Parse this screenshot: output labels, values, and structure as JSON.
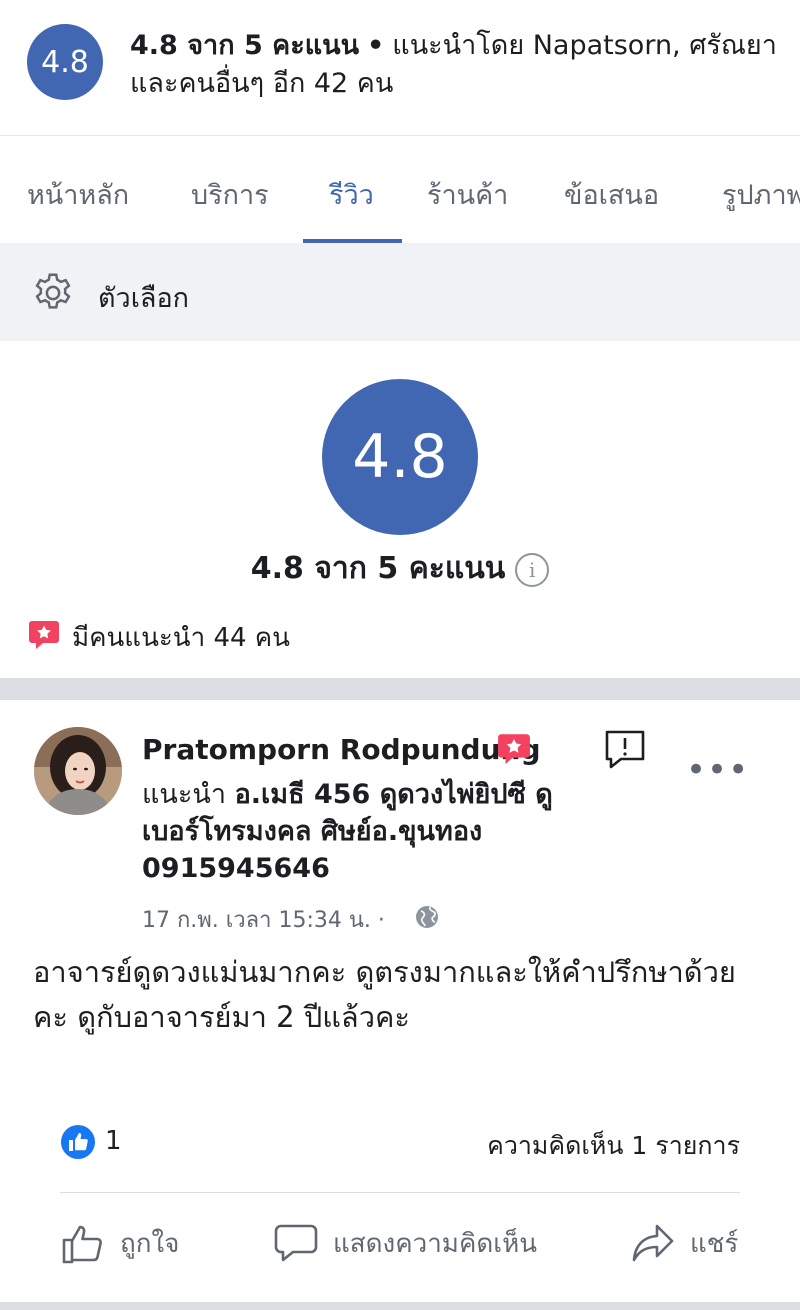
{
  "summary": {
    "badge": "4.8",
    "rating_text": "4.8 จาก 5 คะแนน",
    "dot": "•",
    "recommended_text": "แนะนำโดย Napatsorn, ศรัณยา และคนอื่นๆ อีก 42 คน"
  },
  "tabs": [
    {
      "label": "หน้าหลัก"
    },
    {
      "label": "บริการ"
    },
    {
      "label": "รีวิว",
      "active": true
    },
    {
      "label": "ร้านค้า"
    },
    {
      "label": "ข้อเสนอ"
    },
    {
      "label": "รูปภาพ"
    }
  ],
  "options": {
    "label": "ตัวเลือก",
    "icon": "gear-icon"
  },
  "rating": {
    "badge": "4.8",
    "text": "4.8 จาก 5 คะแนน",
    "info": "i",
    "recommend_count_text": "มีคนแนะนำ 44 คน"
  },
  "post": {
    "author": "Pratomporn Rodpundung",
    "recommend_prefix": "แนะนำ",
    "recommend_target": "อ.เมธี 456 ดูดวงไพ่ยิปซี ดูเบอร์โทรมงคล ศิษย์อ.ขุนทอง 0915945646",
    "timestamp": "17 ก.พ. เวลา 15:34 น. ·",
    "body": "อาจารย์ดูดวงแม่นมากคะ ดูตรงมากและให้คำปรึกษาด้วยคะ ดูกับอาจารย์มา 2 ปีแล้วคะ",
    "more": "•••",
    "like_count": "1",
    "comment_count": "ความคิดเห็น 1 รายการ",
    "actions": {
      "like": "ถูกใจ",
      "comment": "แสดงความคิดเห็น",
      "share": "แชร์"
    }
  },
  "colors": {
    "accent": "#4267b2",
    "badge_red": "#f3425f",
    "like_blue": "#1877f2"
  }
}
